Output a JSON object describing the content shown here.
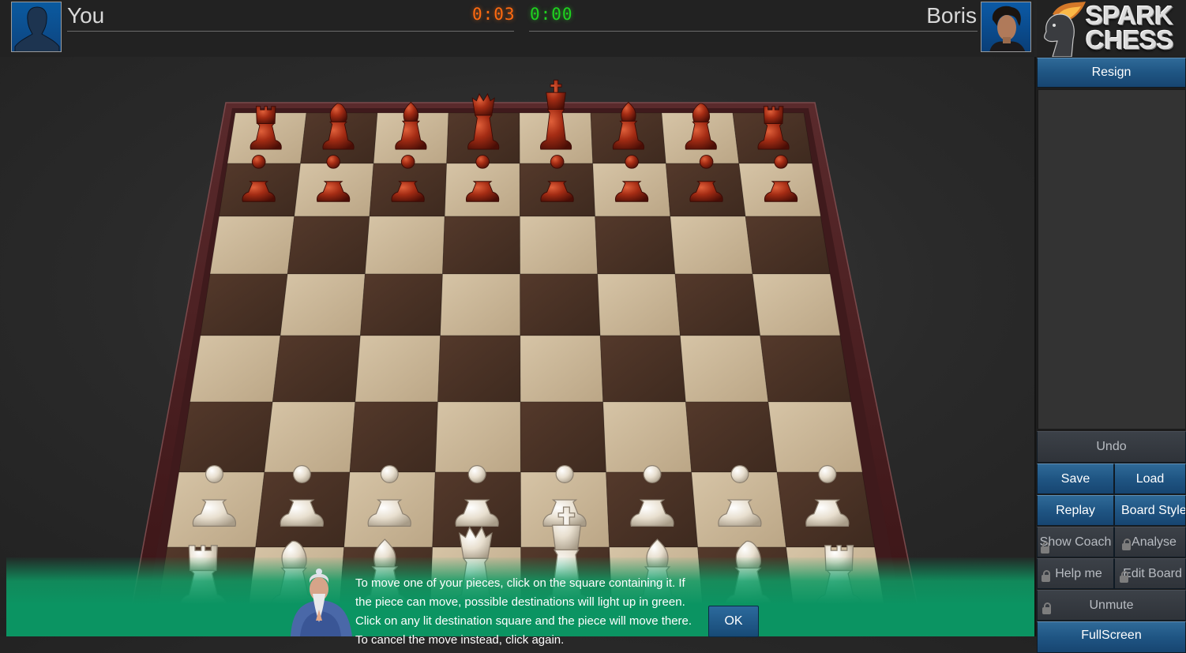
{
  "app": {
    "title": "SparkChess",
    "logo_line1": "SPARK",
    "logo_line2": "CHESS"
  },
  "players": {
    "you": {
      "name": "You",
      "clock": "0:03",
      "clock_color": "#ff6a10",
      "avatar": "silhouette-avatar"
    },
    "opponent": {
      "name": "Boris",
      "clock": "0:00",
      "clock_color": "#1fd21f",
      "avatar": "boris-portrait-avatar"
    }
  },
  "sidebar": {
    "resign": "Resign",
    "undo": "Undo",
    "save": "Save",
    "load": "Load",
    "replay": "Replay",
    "board_style": "Board Style",
    "show_coach": "Show Coach",
    "analyse": "Analyse",
    "help_me": "Help me",
    "edit_board": "Edit Board",
    "unmute": "Unmute",
    "fullscreen": "FullScreen",
    "locked_buttons": [
      "Show Coach",
      "Analyse",
      "Help me",
      "Edit Board",
      "Unmute"
    ],
    "move_list": []
  },
  "coach": {
    "message": "To move one of your pieces, click on the square containing it. If the piece can move, possible destinations will light up in green. Click on any lit destination square and the piece will move there. To cancel the move instead, click again.",
    "ok_label": "OK"
  },
  "board": {
    "position_fen": "rnbqkbnr/pppppppp/8/8/8/8/PPPPPPPP/RNBQKBNR w",
    "ranks_top_to_bottom": [
      [
        "r",
        "n",
        "b",
        "q",
        "k",
        "b",
        "n",
        "r"
      ],
      [
        "p",
        "p",
        "p",
        "p",
        "p",
        "p",
        "p",
        "p"
      ],
      [
        "",
        "",
        "",
        "",
        "",
        "",
        "",
        ""
      ],
      [
        "",
        "",
        "",
        "",
        "",
        "",
        "",
        ""
      ],
      [
        "",
        "",
        "",
        "",
        "",
        "",
        "",
        ""
      ],
      [
        "",
        "",
        "",
        "",
        "",
        "",
        "",
        ""
      ],
      [
        "P",
        "P",
        "P",
        "P",
        "P",
        "P",
        "P",
        "P"
      ],
      [
        "R",
        "N",
        "B",
        "Q",
        "K",
        "B",
        "N",
        "R"
      ]
    ],
    "light_square_color": "#cbb89a",
    "dark_square_color": "#4a3428",
    "frame_color": "#4a1f22",
    "black_piece_color": "#9a2a14",
    "white_piece_color": "#e8dfcf"
  }
}
